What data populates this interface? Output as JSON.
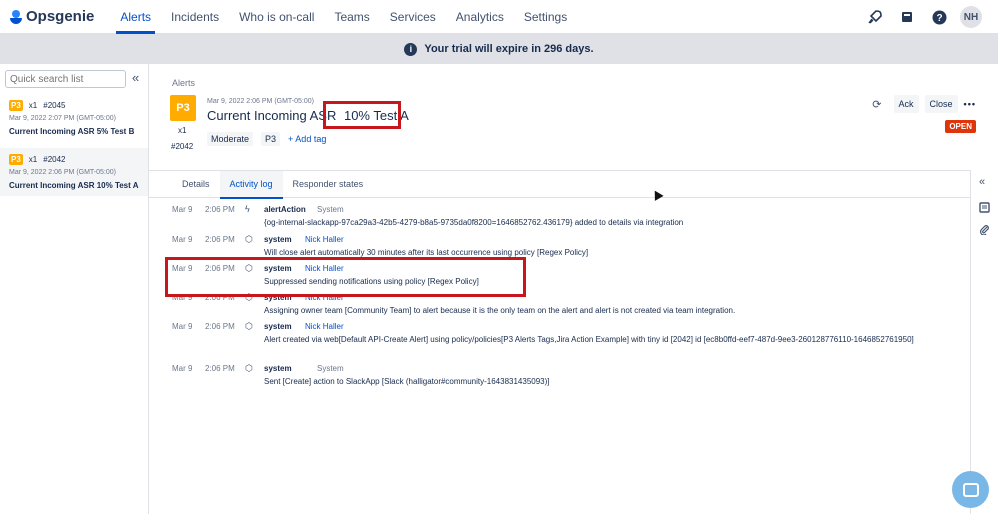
{
  "nav": {
    "brand": "Opsgenie",
    "items": [
      "Alerts",
      "Incidents",
      "Who is on-call",
      "Teams",
      "Services",
      "Analytics",
      "Settings"
    ],
    "active": "Alerts",
    "avatar": "NH",
    "icons": [
      "rocket-icon",
      "book-icon",
      "help-icon"
    ]
  },
  "banner": {
    "text": "Your trial will expire in 296 days."
  },
  "sidebar": {
    "search_placeholder": "Quick search list",
    "alerts": [
      {
        "priority": "P3",
        "count": "x1",
        "id": "#2045",
        "date": "Mar 9, 2022 2:07 PM (GMT-05:00)",
        "title": "Current Incoming ASR 5% Test B"
      },
      {
        "priority": "P3",
        "count": "x1",
        "id": "#2042",
        "date": "Mar 9, 2022 2:06 PM (GMT-05:00)",
        "title": "Current Incoming ASR 10% Test A"
      }
    ]
  },
  "detail": {
    "breadcrumb": "Alerts",
    "priority": "P3",
    "count": "x1",
    "tiny_id": "#2042",
    "date": "Mar 9, 2022 2:06 PM (GMT-05:00)",
    "title_prefix": "Current Incoming ASR",
    "title_highlight": "10% Test A",
    "severity": "Moderate",
    "priority_chip": "P3",
    "add_tag": "+ Add tag",
    "ack": "Ack",
    "close": "Close",
    "more": "•••",
    "status": "OPEN"
  },
  "tabs": [
    "Details",
    "Activity log",
    "Responder states"
  ],
  "active_tab": "Activity log",
  "log": [
    {
      "date": "Mar 9",
      "time": "2:06 PM",
      "icon": "bolt-icon",
      "source": "alertAction",
      "user": "System",
      "user_is_system": true,
      "message": "{og-internal-slackapp-97ca29a3-42b5-4279-b8a5-9735da0f8200=1646852762.436179} added to details via integration"
    },
    {
      "date": "Mar 9",
      "time": "2:06 PM",
      "icon": "cube-icon",
      "source": "system",
      "user": "Nick Haller",
      "user_is_system": false,
      "message": "Will close alert automatically 30 minutes after its last occurrence using policy [Regex Policy]"
    },
    {
      "date": "Mar 9",
      "time": "2:06 PM",
      "icon": "cube-icon",
      "source": "system",
      "user": "Nick Haller",
      "user_is_system": false,
      "message": "Suppressed sending notifications using policy [Regex Policy]"
    },
    {
      "date": "Mar 9",
      "time": "2:06 PM",
      "icon": "cube-icon",
      "source": "system",
      "user": "Nick Haller",
      "user_is_system": false,
      "message": "Assigning owner team [Community Team] to alert because it is the only team on the alert and alert is not created via team integration."
    },
    {
      "date": "Mar 9",
      "time": "2:06 PM",
      "icon": "cube-icon",
      "source": "system",
      "user": "Nick Haller",
      "user_is_system": false,
      "message": "Alert created via web[Default API-Create Alert] using policy/policies[P3 Alerts Tags,Jira Action Example] with tiny id [2042] id [ec8b0ffd-eef7-487d-9ee3-260128776110-1646852761950]"
    },
    {
      "date": "Mar 9",
      "time": "2:06 PM",
      "icon": "cube-icon",
      "source": "system",
      "user": "System",
      "user_is_system": true,
      "message": "Sent [Create] action to SlackApp [Slack (halligator#community-1643831435093)]"
    }
  ]
}
